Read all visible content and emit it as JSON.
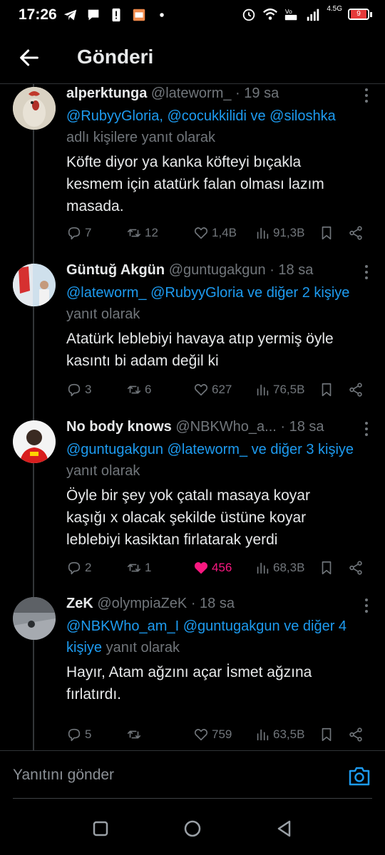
{
  "status": {
    "time": "17:26",
    "network": "4.5G",
    "battery": "9"
  },
  "header": {
    "title": "Gönderi"
  },
  "tweets": [
    {
      "name": "alperktunga",
      "handle": "@lateworm_",
      "time": "· 19 sa",
      "reply_mentions": "@RubyyGloria, @cocukkilidi ve @siloshka",
      "reply_suffix": "adlı kişilere yanıt olarak",
      "text_lines": [
        "Köfte diyor ya kanka köfteyi bıçakla",
        "kesmem için atatürk falan olması lazım",
        "masada."
      ],
      "replies": "7",
      "retweets": "12",
      "likes": "1,4B",
      "views": "91,3B",
      "liked": false
    },
    {
      "name": "Güntuğ Akgün",
      "handle": "@guntugakgun",
      "time": "· 18 sa",
      "reply_mentions": "@lateworm_ @RubyyGloria ve diğer 2 kişiye",
      "reply_suffix": " yanıt olarak",
      "text_lines": [
        "Atatürk leblebiyi havaya atıp yermiş öyle",
        "kasıntı bi adam değil ki"
      ],
      "replies": "3",
      "retweets": "6",
      "likes": "627",
      "views": "76,5B",
      "liked": false
    },
    {
      "name": "No body knows",
      "handle": "@NBKWho_a...",
      "time": "· 18 sa",
      "reply_mentions": "@guntugakgun @lateworm_ ve diğer 3 kişiye",
      "reply_suffix": " yanıt olarak",
      "text_lines": [
        "Öyle bir şey yok çatalı masaya koyar",
        "kaşığı x olacak şekilde üstüne koyar",
        "leblebiyi kasiktan firlatarak yerdi"
      ],
      "replies": "2",
      "retweets": "1",
      "likes": "456",
      "views": "68,3B",
      "liked": true
    },
    {
      "name": "ZeK",
      "handle": "@olympiaZeK",
      "time": "· 18 sa",
      "reply_mentions": "@NBKWho_am_I @guntugakgun ve diğer 4 kişiye",
      "reply_suffix": " yanıt olarak",
      "text_lines": [
        "Hayır, Atam ağzını açar İsmet ağzına",
        "fırlatırdı."
      ],
      "replies": "5",
      "retweets": "",
      "likes": "759",
      "views": "63,5B",
      "liked": false
    }
  ],
  "composer": {
    "placeholder": "Yanıtını gönder"
  },
  "colors": {
    "accent": "#1d9bf0",
    "like": "#f91880",
    "muted": "#71767b",
    "text": "#e7e9ea"
  }
}
